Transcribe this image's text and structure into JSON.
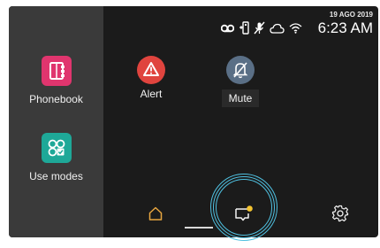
{
  "sidebar": {
    "items": [
      {
        "label": "Phonebook",
        "icon": "phonebook-icon",
        "color": "#e0356e"
      },
      {
        "label": "Use modes",
        "icon": "use-modes-icon",
        "color": "#1ea898"
      }
    ]
  },
  "status_bar": {
    "date": "19 AGO 2019",
    "time": "6:23 AM",
    "icons": [
      "answering-machine-icon",
      "door-phone-icon",
      "mic-off-icon",
      "cloud-icon",
      "wifi-icon"
    ]
  },
  "quick_actions": [
    {
      "label": "Alert",
      "icon": "alert-icon",
      "color": "#e0443e"
    },
    {
      "label": "Mute",
      "icon": "mute-icon",
      "color": "#5a6f86"
    }
  ],
  "bottom_nav": {
    "items": [
      "home-icon",
      "messages-icon",
      "settings-icon"
    ],
    "active": "home",
    "accent": "#e8a640",
    "notification_color": "#f4c430"
  }
}
